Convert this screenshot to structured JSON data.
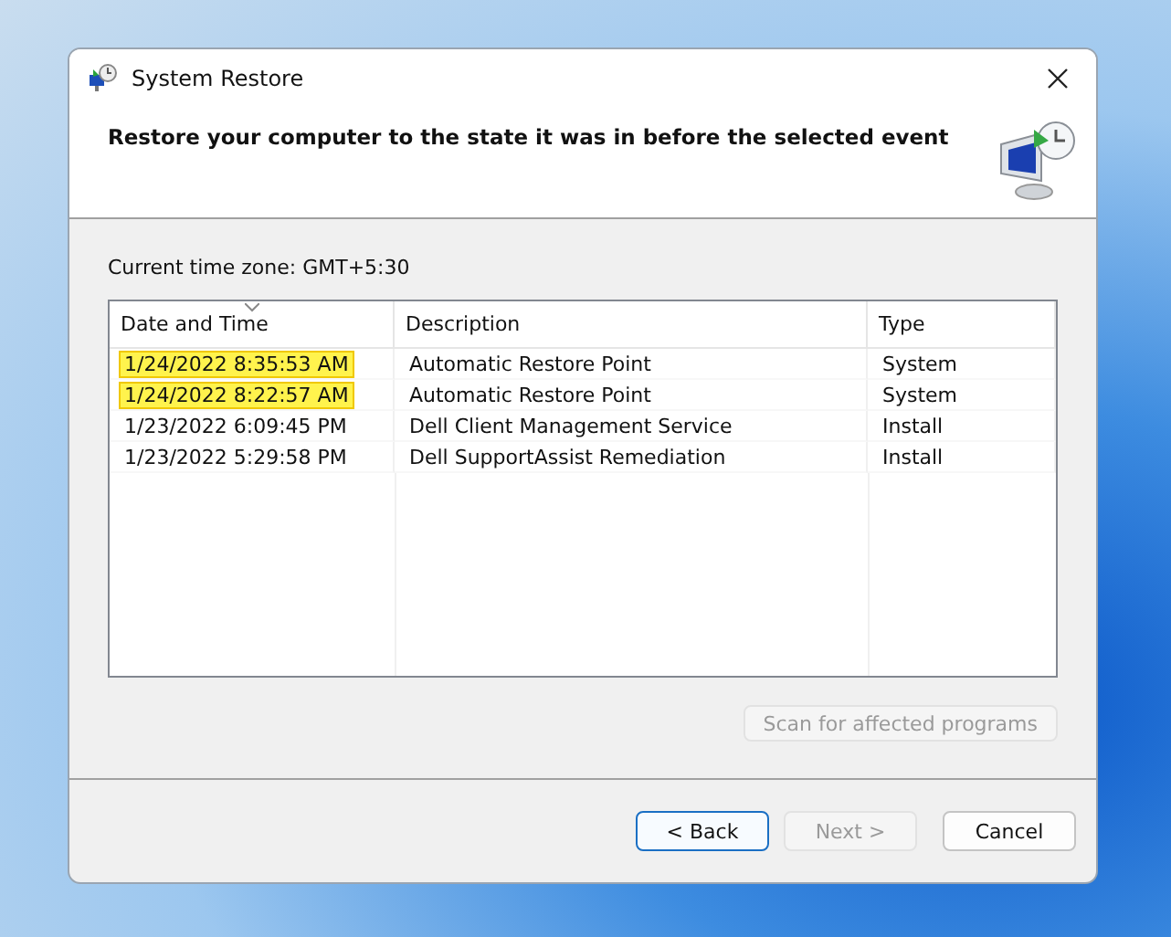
{
  "window": {
    "title": "System Restore"
  },
  "heading": "Restore your computer to the state it was in before the selected event",
  "time_zone": "Current time zone: GMT+5:30",
  "table": {
    "columns": [
      {
        "label": "Date and Time",
        "sorted": true
      },
      {
        "label": "Description",
        "sorted": false
      },
      {
        "label": "Type",
        "sorted": false
      }
    ],
    "rows": [
      {
        "cells": [
          "1/24/2022 8:35:53 AM",
          "Automatic Restore Point",
          "System"
        ],
        "highlighted": true
      },
      {
        "cells": [
          "1/24/2022 8:22:57 AM",
          "Automatic Restore Point",
          "System"
        ],
        "highlighted": true
      },
      {
        "cells": [
          "1/23/2022 6:09:45 PM",
          "Dell Client Management Service",
          "Install"
        ],
        "highlighted": false
      },
      {
        "cells": [
          "1/23/2022 5:29:58 PM",
          "Dell SupportAssist Remediation",
          "Install"
        ],
        "highlighted": false
      }
    ]
  },
  "scan_button": {
    "label": "Scan for affected programs",
    "disabled": true
  },
  "buttons": [
    {
      "label": "< Back",
      "disabled": false,
      "default": true
    },
    {
      "label": "Next >",
      "disabled": true,
      "default": false
    },
    {
      "label": "Cancel",
      "disabled": false,
      "default": false
    }
  ]
}
